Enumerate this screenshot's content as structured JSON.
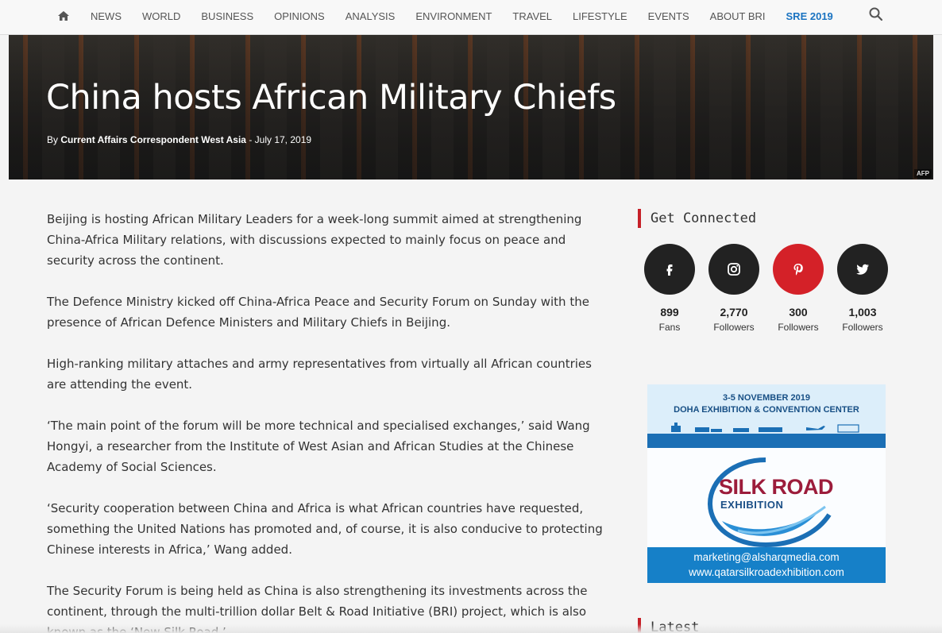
{
  "nav": {
    "home_icon": "home-icon",
    "items": [
      {
        "label": "NEWS"
      },
      {
        "label": "WORLD"
      },
      {
        "label": "BUSINESS"
      },
      {
        "label": "OPINIONS"
      },
      {
        "label": "ANALYSIS"
      },
      {
        "label": "ENVIRONMENT"
      },
      {
        "label": "TRAVEL"
      },
      {
        "label": "LIFESTYLE"
      },
      {
        "label": "EVENTS"
      },
      {
        "label": "ABOUT BRI"
      },
      {
        "label": "SRE 2019"
      }
    ],
    "search_icon": "search-icon",
    "accent_color": "#1a73c1"
  },
  "hero": {
    "title": "China hosts African Military Chiefs",
    "by": "By",
    "author": "Current Affairs Correspondent West Asia",
    "separator": "-",
    "date": "July 17, 2019",
    "photo_credit": "AFP"
  },
  "article": {
    "paragraphs": [
      "Beijing is hosting African Military Leaders for a week-long summit aimed at strengthening China-Africa Military relations, with discussions expected to mainly focus on peace and security across the continent.",
      "The Defence Ministry kicked off China-Africa Peace and Security Forum on Sunday with the presence of African Defence Ministers and Military Chiefs in Beijing.",
      "High-ranking military attaches and army representatives from virtually all African countries are attending the event.",
      "‘The main point of the forum will be more technical and specialised exchanges,’ said Wang Hongyi, a researcher from the Institute of West Asian and African Studies at the Chinese Academy of Social Sciences.",
      "‘Security cooperation between China and Africa is what African countries have requested, something the United Nations has promoted and, of course, it is also conducive to protecting Chinese interests in Africa,’ Wang added.",
      "The Security Forum is being held as China is also strengthening its investments across the continent, through the multi-trillion dollar Belt & Road Initiative (BRI) project, which is also known as the ‘New Silk Road.’"
    ]
  },
  "sidebar": {
    "get_connected": "Get Connected",
    "social": [
      {
        "icon": "facebook-icon",
        "count": "899",
        "label": "Fans"
      },
      {
        "icon": "instagram-icon",
        "count": "2,770",
        "label": "Followers"
      },
      {
        "icon": "pinterest-icon",
        "count": "300",
        "label": "Followers"
      },
      {
        "icon": "twitter-icon",
        "count": "1,003",
        "label": "Followers"
      }
    ],
    "latest": "Latest",
    "accent_color": "#c62028"
  },
  "ad": {
    "dates": "3-5 NOVEMBER 2019",
    "venue": "DOHA EXHIBITION & CONVENTION CENTER",
    "title_line1": "SILK ROAD",
    "title_line2": "EXHIBITION",
    "email": "marketing@alsharqmedia.com",
    "website": "www.qatarsilkroadexhibition.com"
  }
}
